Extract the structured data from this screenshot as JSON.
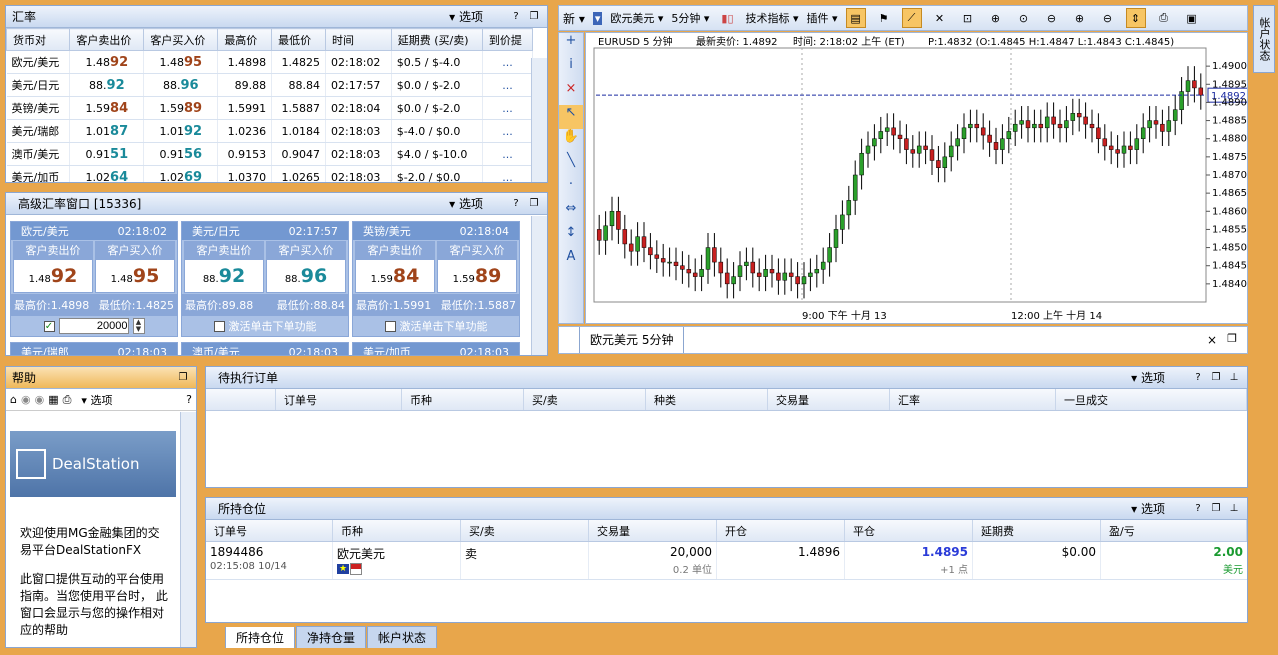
{
  "rates": {
    "title": "汇率",
    "options": "选项",
    "columns": [
      "货币对",
      "客户卖出价",
      "客户买入价",
      "最高价",
      "最低价",
      "时间",
      "延期费 (买/卖)",
      "到价提"
    ],
    "rows": [
      {
        "pair": "欧元/美元",
        "sell_a": "1.48",
        "sell_b": "92",
        "buy_a": "1.48",
        "buy_b": "95",
        "high": "1.4898",
        "low": "1.4825",
        "time": "02:18:02",
        "rollover": "$0.5 / $-4.0",
        "alert": "...",
        "dir": "dn"
      },
      {
        "pair": "美元/日元",
        "sell_a": "88.",
        "sell_b": "92",
        "buy_a": "88.",
        "buy_b": "96",
        "high": "89.88",
        "low": "88.84",
        "time": "02:17:57",
        "rollover": "$0.0 / $-2.0",
        "alert": "...",
        "dir": "up"
      },
      {
        "pair": "英镑/美元",
        "sell_a": "1.59",
        "sell_b": "84",
        "buy_a": "1.59",
        "buy_b": "89",
        "high": "1.5991",
        "low": "1.5887",
        "time": "02:18:04",
        "rollover": "$0.0 / $-2.0",
        "alert": "...",
        "dir": "dn"
      },
      {
        "pair": "美元/瑞郎",
        "sell_a": "1.01",
        "sell_b": "87",
        "buy_a": "1.01",
        "buy_b": "92",
        "high": "1.0236",
        "low": "1.0184",
        "time": "02:18:03",
        "rollover": "$-4.0 / $0.0",
        "alert": "...",
        "dir": "up"
      },
      {
        "pair": "澳币/美元",
        "sell_a": "0.91",
        "sell_b": "51",
        "buy_a": "0.91",
        "buy_b": "56",
        "high": "0.9153",
        "low": "0.9047",
        "time": "02:18:03",
        "rollover": "$4.0 / $-10.0",
        "alert": "...",
        "dir": "up"
      },
      {
        "pair": "美元/加币",
        "sell_a": "1.02",
        "sell_b": "64",
        "buy_a": "1.02",
        "buy_b": "69",
        "high": "1.0370",
        "low": "1.0265",
        "time": "02:18:03",
        "rollover": "$-2.0 / $0.0",
        "alert": "...",
        "dir": "up"
      }
    ]
  },
  "advanced": {
    "title": "高级汇率窗口 [15336]",
    "options": "选项",
    "sell_label": "客户卖出价",
    "buy_label": "客户买入价",
    "activate_label": "激活单击下单功能",
    "tiles": [
      {
        "pair": "欧元/美元",
        "time": "02:18:02",
        "sell_a": "1.48",
        "sell_b": "92",
        "buy_a": "1.48",
        "buy_b": "95",
        "high": "最高价:1.4898",
        "low": "最低价:1.4825",
        "dir": "dn",
        "qty": "20000"
      },
      {
        "pair": "美元/日元",
        "time": "02:17:57",
        "sell_a": "88.",
        "sell_b": "92",
        "buy_a": "88.",
        "buy_b": "96",
        "high": "最高价:89.88",
        "low": "最低价:88.84",
        "dir": "up"
      },
      {
        "pair": "英镑/美元",
        "time": "02:18:04",
        "sell_a": "1.59",
        "sell_b": "84",
        "buy_a": "1.59",
        "buy_b": "89",
        "high": "最高价:1.5991",
        "low": "最低价:1.5887",
        "dir": "dn"
      }
    ],
    "next_row": [
      {
        "pair": "美元/瑞郎",
        "time": "02:18:03"
      },
      {
        "pair": "澳币/美元",
        "time": "02:18:03"
      },
      {
        "pair": "美元/加币",
        "time": "02:18:03"
      }
    ]
  },
  "toolbar": {
    "new_label": "新",
    "symbol": "欧元美元",
    "interval": "5分钟",
    "indicators": "技术指标",
    "plugins": "插件"
  },
  "chart": {
    "header_symbol": "EURUSD  5 分钟",
    "header_last": "最新卖价: 1.4892",
    "header_time": "时间: 2:18:02 上午 (ET)",
    "header_ohlc": "P:1.4832 (O:1.4845 H:1.4847 L:1.4843 C:1.4845)",
    "current_price_label": "1.4892",
    "x_labels": [
      "9:00 下午 十月 13",
      "12:00 上午 十月 14"
    ],
    "tab_label": "欧元美元 5分钟",
    "side_label": "帐户状态"
  },
  "chart_data": {
    "type": "candlestick",
    "title": "EURUSD 5 分钟",
    "ylim": [
      1.4835,
      1.4905
    ],
    "y_ticks": [
      "1.4900",
      "1.4895",
      "1.4890",
      "1.4885",
      "1.4880",
      "1.4875",
      "1.4870",
      "1.4865",
      "1.4860",
      "1.4855",
      "1.4850",
      "1.4845",
      "1.4840"
    ],
    "last_price": 1.4892,
    "closes": [
      1.4852,
      1.4856,
      1.486,
      1.4855,
      1.4851,
      1.4849,
      1.4853,
      1.485,
      1.4848,
      1.4847,
      1.4846,
      1.4846,
      1.4845,
      1.4844,
      1.4843,
      1.4842,
      1.4844,
      1.485,
      1.4846,
      1.4843,
      1.484,
      1.4842,
      1.4845,
      1.4846,
      1.4843,
      1.4842,
      1.4844,
      1.4843,
      1.4841,
      1.4843,
      1.4842,
      1.484,
      1.4842,
      1.4843,
      1.4844,
      1.4846,
      1.485,
      1.4855,
      1.4859,
      1.4863,
      1.487,
      1.4876,
      1.4878,
      1.488,
      1.4882,
      1.4883,
      1.4881,
      1.488,
      1.4877,
      1.4876,
      1.4878,
      1.4877,
      1.4874,
      1.4872,
      1.4875,
      1.4878,
      1.488,
      1.4883,
      1.4884,
      1.4883,
      1.4881,
      1.4879,
      1.4877,
      1.488,
      1.4882,
      1.4884,
      1.4885,
      1.4883,
      1.4884,
      1.4883,
      1.4886,
      1.4884,
      1.4883,
      1.4885,
      1.4887,
      1.4886,
      1.4884,
      1.4883,
      1.488,
      1.4878,
      1.4877,
      1.4876,
      1.4878,
      1.4877,
      1.488,
      1.4883,
      1.4885,
      1.4884,
      1.4882,
      1.4885,
      1.4888,
      1.4893,
      1.4896,
      1.4894,
      1.4892
    ]
  },
  "help": {
    "title": "帮助",
    "options": "选项",
    "logo": "DealStation",
    "p1": "欢迎使用MG金融集团的交易平台DealStationFX",
    "p2": "此窗口提供互动的平台使用指南。当您使用平台时， 此窗口会显示与您的操作相对应的帮助"
  },
  "pending": {
    "title": "待执行订单",
    "options": "选项",
    "columns": [
      "订单号",
      "币种",
      "买/卖",
      "种类",
      "交易量",
      "汇率",
      "一旦成交"
    ]
  },
  "positions": {
    "title": "所持仓位",
    "options": "选项",
    "columns": [
      "订单号",
      "币种",
      "买/卖",
      "交易量",
      "开仓",
      "平仓",
      "延期费",
      "盈/亏"
    ],
    "row": {
      "order": "1894486",
      "datetime": "02:15:08 10/14",
      "pair": "欧元美元",
      "side": "卖",
      "qty": "20,000",
      "lots": "0.2 单位",
      "open": "1.4896",
      "close": "1.4895",
      "pips": "+1 点",
      "rollover": "$0.00",
      "pl": "2.00",
      "ccy": "美元"
    },
    "tabs": [
      "所持仓位",
      "净持仓量",
      "帐户状态"
    ]
  }
}
